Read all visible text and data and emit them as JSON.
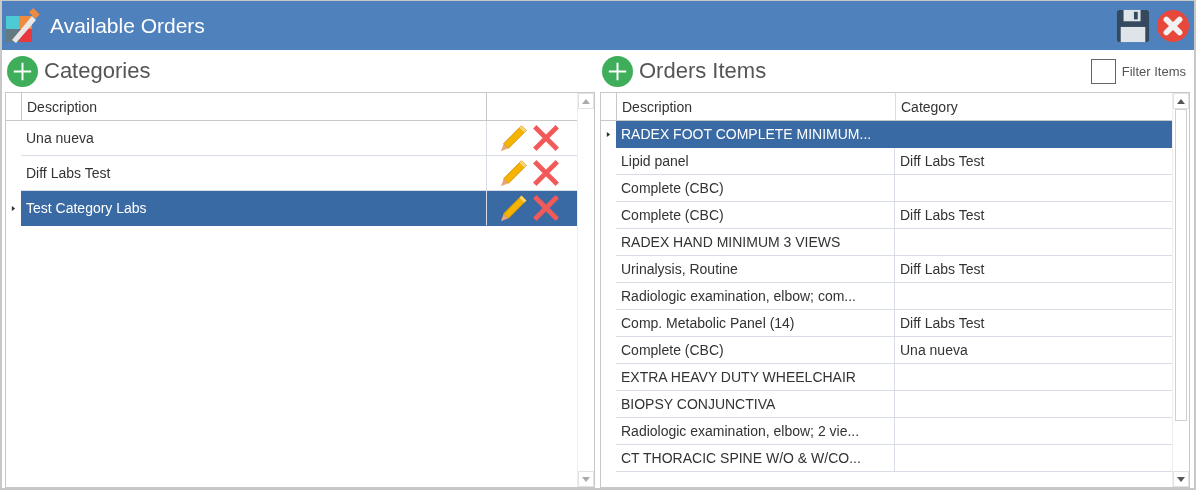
{
  "window": {
    "title": "Available Orders"
  },
  "categories": {
    "title": "Categories",
    "columns": [
      "Description"
    ],
    "rows": [
      {
        "description": "Una nueva",
        "selected": false
      },
      {
        "description": "Diff Labs Test",
        "selected": false
      },
      {
        "description": "Test Category Labs",
        "selected": true
      }
    ]
  },
  "order_items": {
    "title": "Orders Items",
    "filter": {
      "label": "Filter Items",
      "checked": false
    },
    "columns": [
      "Description",
      "Category"
    ],
    "rows": [
      {
        "description": "RADEX FOOT COMPLETE MINIMUM...",
        "category": "",
        "selected": true
      },
      {
        "description": "Lipid panel",
        "category": "Diff Labs Test",
        "selected": false
      },
      {
        "description": "Complete (CBC)",
        "category": "",
        "selected": false
      },
      {
        "description": "Complete (CBC)",
        "category": "Diff Labs Test",
        "selected": false
      },
      {
        "description": "RADEX HAND MINIMUM 3 VIEWS",
        "category": "",
        "selected": false
      },
      {
        "description": "Urinalysis, Routine",
        "category": "Diff Labs Test",
        "selected": false
      },
      {
        "description": "Radiologic examination, elbow; com...",
        "category": "",
        "selected": false
      },
      {
        "description": "Comp. Metabolic Panel (14)",
        "category": "Diff Labs Test",
        "selected": false
      },
      {
        "description": "Complete (CBC)",
        "category": "Una nueva",
        "selected": false
      },
      {
        "description": "EXTRA HEAVY DUTY WHEELCHAIR",
        "category": "",
        "selected": false
      },
      {
        "description": "BIOPSY CONJUNCTIVA",
        "category": "",
        "selected": false
      },
      {
        "description": "Radiologic examination, elbow; 2 vie...",
        "category": "",
        "selected": false
      },
      {
        "description": "CT THORACIC SPINE W/O & W/CO...",
        "category": "",
        "selected": false
      }
    ]
  }
}
